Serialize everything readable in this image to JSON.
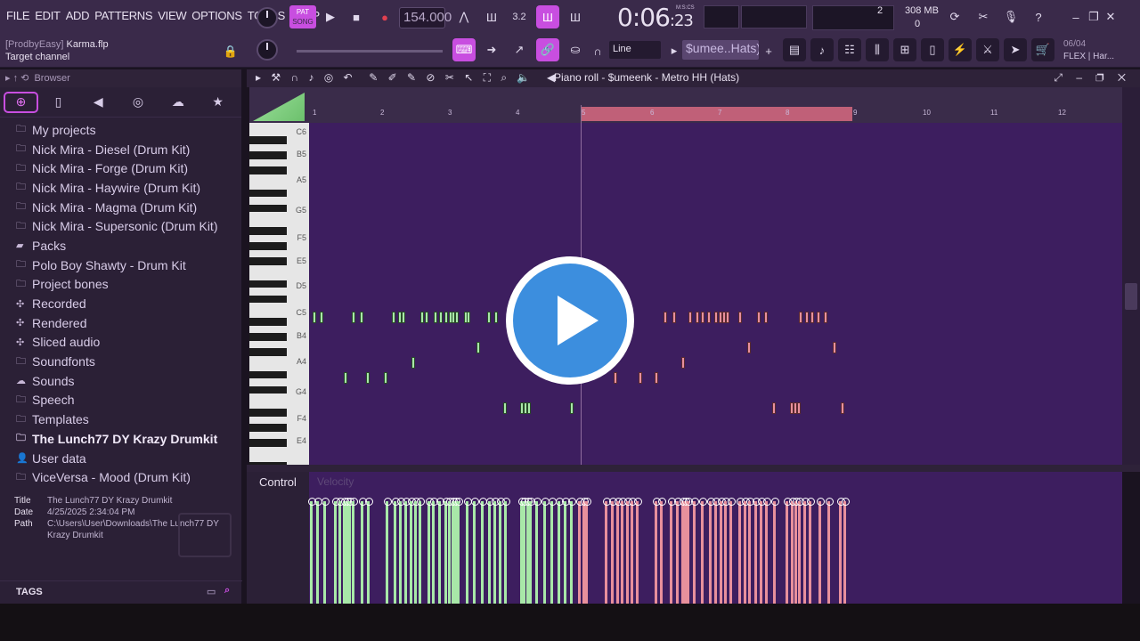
{
  "menu": [
    "FILE",
    "EDIT",
    "ADD",
    "PATTERNS",
    "VIEW",
    "OPTIONS",
    "TOOLS",
    "HELP"
  ],
  "project": {
    "author": "[ProdbyEasy]",
    "file": "Karma.flp",
    "target": "Target channel"
  },
  "transport": {
    "pat_label": "PAT",
    "song_label": "SONG",
    "tempo": "154.000",
    "time_main": "0:06",
    "time_sub": "23",
    "time_format": "M:S:CS"
  },
  "status": {
    "cpu": "2",
    "memory": "308 MB",
    "polyphony": "0"
  },
  "toolbar": {
    "snap_mode": "Line",
    "channel": "$umee..Hats)",
    "date": "06/04",
    "hint": "FLEX | Har..."
  },
  "browser": {
    "title": "Browser",
    "items": [
      {
        "label": "My projects",
        "icon": "folder-icon",
        "bold": false
      },
      {
        "label": "Nick Mira - Diesel (Drum Kit)",
        "icon": "folder-icon",
        "bold": false
      },
      {
        "label": "Nick Mira - Forge (Drum Kit)",
        "icon": "folder-icon",
        "bold": false
      },
      {
        "label": "Nick Mira - Haywire (Drum Kit)",
        "icon": "folder-icon",
        "bold": false
      },
      {
        "label": "Nick Mira - Magma (Drum Kit)",
        "icon": "folder-icon",
        "bold": false
      },
      {
        "label": "Nick Mira - Supersonic (Drum Kit)",
        "icon": "folder-icon",
        "bold": false
      },
      {
        "label": "Packs",
        "icon": "pack-icon",
        "bold": false
      },
      {
        "label": "Polo Boy Shawty - Drum Kit",
        "icon": "folder-icon",
        "bold": false
      },
      {
        "label": "Project bones",
        "icon": "folder-icon",
        "bold": false
      },
      {
        "label": "Recorded",
        "icon": "recorded-icon",
        "bold": false
      },
      {
        "label": "Rendered",
        "icon": "rendered-icon",
        "bold": false
      },
      {
        "label": "Sliced audio",
        "icon": "sliced-icon",
        "bold": false
      },
      {
        "label": "Soundfonts",
        "icon": "folder-icon",
        "bold": false
      },
      {
        "label": "Sounds",
        "icon": "cloud-icon",
        "bold": false
      },
      {
        "label": "Speech",
        "icon": "folder-icon",
        "bold": false
      },
      {
        "label": "Templates",
        "icon": "folder-icon",
        "bold": false
      },
      {
        "label": "The Lunch77 DY Krazy Drumkit",
        "icon": "folder-icon",
        "bold": true
      },
      {
        "label": "User data",
        "icon": "user-icon",
        "bold": false
      },
      {
        "label": "ViceVersa - Mood (Drum Kit)",
        "icon": "folder-icon",
        "bold": false
      }
    ],
    "meta": {
      "title_key": "Title",
      "title": "The Lunch77 DY Krazy Drumkit",
      "date_key": "Date",
      "date": "4/25/2025 2:34:04 PM",
      "path_key": "Path",
      "path": "C:\\Users\\User\\Downloads\\The Lunch77 DY Krazy Drumkit"
    },
    "tags_label": "TAGS"
  },
  "piano_roll": {
    "title": "Piano roll - $umeenk - Metro HH (Hats)",
    "bars": [
      "1",
      "2",
      "3",
      "4",
      "5",
      "6",
      "7",
      "8",
      "9",
      "10",
      "11",
      "12"
    ],
    "key_labels": [
      "C6",
      "B5",
      "A5",
      "G5",
      "F5",
      "E5",
      "D5",
      "C5",
      "B4",
      "A4",
      "G4",
      "F4",
      "E4"
    ],
    "control_label": "Control",
    "control_target": "Velocity"
  },
  "colors": {
    "accent": "#c84ee0",
    "note_green": "#a8e8a8",
    "note_red": "#e8909c",
    "grid": "#3d1e5f"
  }
}
